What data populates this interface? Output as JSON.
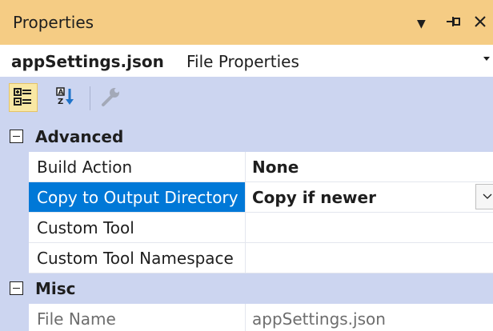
{
  "panel": {
    "title": "Properties",
    "controls": [
      {
        "name": "window-position-dropdown-icon",
        "glyph": "▼"
      },
      {
        "name": "pin-icon",
        "glyph": "⊣"
      },
      {
        "name": "close-icon",
        "glyph": "✕"
      }
    ]
  },
  "selector": {
    "object_name": "appSettings.json",
    "object_type": "File Properties"
  },
  "toolbar": {
    "buttons": [
      {
        "name": "categorized-view-icon",
        "active": true
      },
      {
        "name": "alphabetical-sort-icon",
        "active": false
      },
      {
        "name": "property-pages-icon",
        "active": false,
        "disabled": true
      }
    ]
  },
  "grid": {
    "categories": [
      {
        "label": "Advanced",
        "expanded": true,
        "properties": [
          {
            "name": "Build Action",
            "value": "None",
            "bold": true
          },
          {
            "name": "Copy to Output Directory",
            "value": "Copy if newer",
            "bold": true,
            "selected": true,
            "has_dropdown": true
          },
          {
            "name": "Custom Tool",
            "value": ""
          },
          {
            "name": "Custom Tool Namespace",
            "value": ""
          }
        ]
      },
      {
        "label": "Misc",
        "expanded": true,
        "properties": [
          {
            "name": "File Name",
            "value": "appSettings.json",
            "readonly": true
          }
        ]
      }
    ]
  },
  "colors": {
    "title_bar": "#f5cc84",
    "toolbar": "#ccd5f0",
    "selection": "#0078d7",
    "readonly_text": "#6d6d6d"
  }
}
